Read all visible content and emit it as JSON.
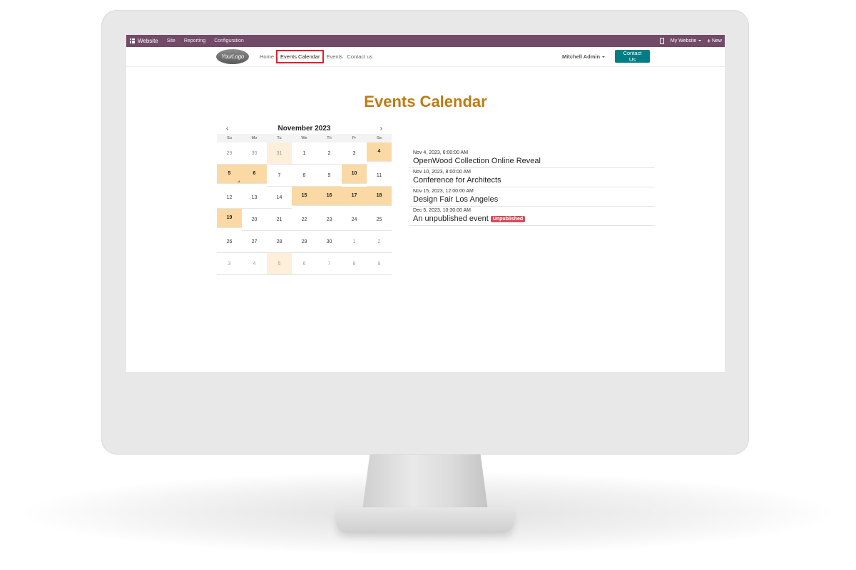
{
  "admin_bar": {
    "brand": "Website",
    "menu": [
      "Site",
      "Reporting",
      "Configuration"
    ],
    "website_selector": "My Website",
    "new_label": "New"
  },
  "navbar": {
    "logo_text": "YourLogo",
    "links": [
      "Home",
      "Events Calendar",
      "Events",
      "Contact us"
    ],
    "active_link": "Events Calendar",
    "user": "Mitchell Admin",
    "contact_button": "Contact Us"
  },
  "page": {
    "title": "Events Calendar"
  },
  "calendar": {
    "month_label": "November 2023",
    "prev": "‹",
    "next": "›",
    "weekdays": [
      "Su",
      "Mo",
      "Tu",
      "We",
      "Th",
      "Fr",
      "Sa"
    ],
    "weeks": [
      [
        "29",
        "30",
        "31",
        "1",
        "2",
        "3",
        "4"
      ],
      [
        "5",
        "6",
        "7",
        "8",
        "9",
        "10",
        "11"
      ],
      [
        "12",
        "13",
        "14",
        "15",
        "16",
        "17",
        "18"
      ],
      [
        "19",
        "20",
        "21",
        "22",
        "23",
        "24",
        "25"
      ],
      [
        "26",
        "27",
        "28",
        "29",
        "30",
        "1",
        "2"
      ],
      [
        "3",
        "4",
        "5",
        "6",
        "7",
        "8",
        "9"
      ]
    ]
  },
  "events": [
    {
      "date": "Nov 4, 2023, 6:00:00 AM",
      "title": "OpenWood Collection Online Reveal",
      "badge": ""
    },
    {
      "date": "Nov 10, 2023, 8:00:00 AM",
      "title": "Conference for Architects",
      "badge": ""
    },
    {
      "date": "Nov 15, 2023, 12:00:00 AM",
      "title": "Design Fair Los Angeles",
      "badge": ""
    },
    {
      "date": "Dec 5, 2023, 10:30:00 AM",
      "title": "An unpublished event",
      "badge": "Unpublished"
    }
  ],
  "colors": {
    "admin_bar": "#714b67",
    "accent_title": "#c17a0f",
    "event_day": "#fbd9a4",
    "contact_button": "#017e84",
    "badge": "#d44c59"
  }
}
